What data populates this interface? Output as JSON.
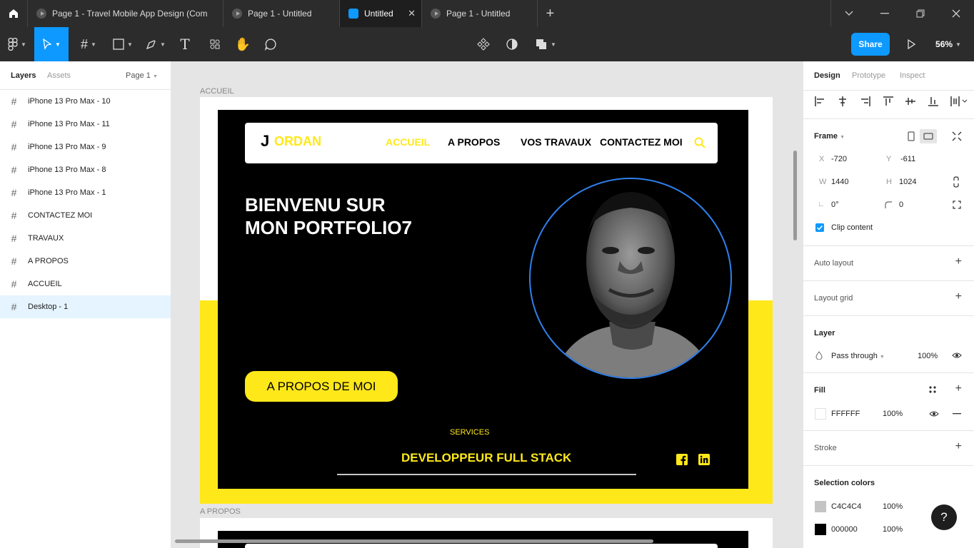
{
  "tabs": [
    {
      "label": "Page 1 - Travel Mobile App Design (Com",
      "active": false
    },
    {
      "label": "Page 1 - Untitled",
      "active": false
    },
    {
      "label": "Untitled",
      "active": true
    },
    {
      "label": "Page 1 - Untitled",
      "active": false
    }
  ],
  "toolbar": {
    "share_label": "Share",
    "zoom": "56%"
  },
  "left_panel": {
    "tab_layers": "Layers",
    "tab_assets": "Assets",
    "page_selector": "Page 1",
    "layers": [
      "iPhone 13 Pro Max - 10",
      "iPhone 13 Pro Max - 11",
      "iPhone 13 Pro Max - 9",
      "iPhone 13 Pro Max - 8",
      "iPhone 13 Pro Max - 1",
      "CONTACTEZ MOI",
      "TRAVAUX",
      "A PROPOS",
      "ACCUEIL",
      "Desktop - 1"
    ],
    "selected_layer": "Desktop - 1"
  },
  "canvas": {
    "frame_label_accueil": "ACCUEIL",
    "frame_label_apropos": "A PROPOS",
    "site": {
      "logo_j": "J",
      "logo_rest": "ORDAN",
      "nav": [
        "ACCUEIL",
        "A PROPOS",
        "VOS TRAVAUX",
        "CONTACTEZ MOI"
      ],
      "hero_line1": "BIENVENU SUR",
      "hero_line2": "MON PORTFOLIO7",
      "cta_button": "A PROPOS DE MOI",
      "services_label": "SERVICES",
      "services_title": "DEVELOPPEUR FULL STACK",
      "accent_color": "#ffe81a"
    }
  },
  "right_panel": {
    "tabs": [
      "Design",
      "Prototype",
      "Inspect"
    ],
    "frame_label": "Frame",
    "x_label": "X",
    "x_value": "-720",
    "y_label": "Y",
    "y_value": "-611",
    "w_label": "W",
    "w_value": "1440",
    "h_label": "H",
    "h_value": "1024",
    "rotation": "0°",
    "radius": "0",
    "clip_content": "Clip content",
    "auto_layout": "Auto layout",
    "layout_grid": "Layout grid",
    "layer_title": "Layer",
    "blend_mode": "Pass through",
    "layer_opacity": "100%",
    "fill_title": "Fill",
    "fill_hex": "FFFFFF",
    "fill_opacity": "100%",
    "stroke_title": "Stroke",
    "selection_colors_title": "Selection colors",
    "selection_colors": [
      {
        "hex": "C4C4C4",
        "opacity": "100%",
        "color": "#c4c4c4"
      },
      {
        "hex": "000000",
        "opacity": "100%",
        "color": "#000000"
      }
    ]
  },
  "help_button": "?"
}
